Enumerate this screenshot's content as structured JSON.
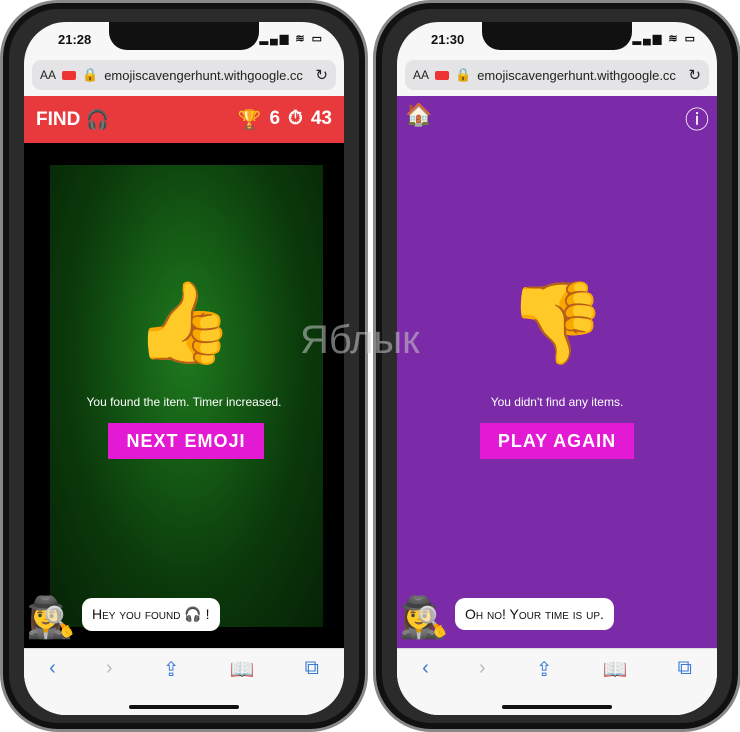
{
  "browser": {
    "url": "emojiscavengerhunt.withgoogle.cc",
    "text_size": "AA",
    "status_icons": "▂▄▆ ≋ ▭"
  },
  "left": {
    "time": "21:28",
    "header": {
      "find_label": "FIND",
      "target_emoji": "🎧",
      "trophy_icon": "🏆",
      "score": "6",
      "timer_icon": "⏱",
      "time_left": "43"
    },
    "result_emoji": "👍",
    "message": "You found the item. Timer increased.",
    "button": "NEXT EMOJI",
    "detective": "🕵️‍♀️",
    "bubble": "Hey you found 🎧 !"
  },
  "right": {
    "time": "21:30",
    "home_icon": "🏠",
    "info_icon": "ⓘ",
    "result_emoji": "👎",
    "message": "You didn't find any items.",
    "button": "PLAY AGAIN",
    "detective": "🕵️‍♀️",
    "bubble": "Oh no! Your time is up."
  },
  "toolbar": {
    "back": "‹",
    "forward": "›",
    "share": "⇪",
    "bookmarks": "📖",
    "tabs": "⧉"
  },
  "watermark": "Яблык",
  "colors": {
    "header_red": "#e8393d",
    "purple": "#7b2aa8",
    "button_magenta": "#e21ad4"
  }
}
